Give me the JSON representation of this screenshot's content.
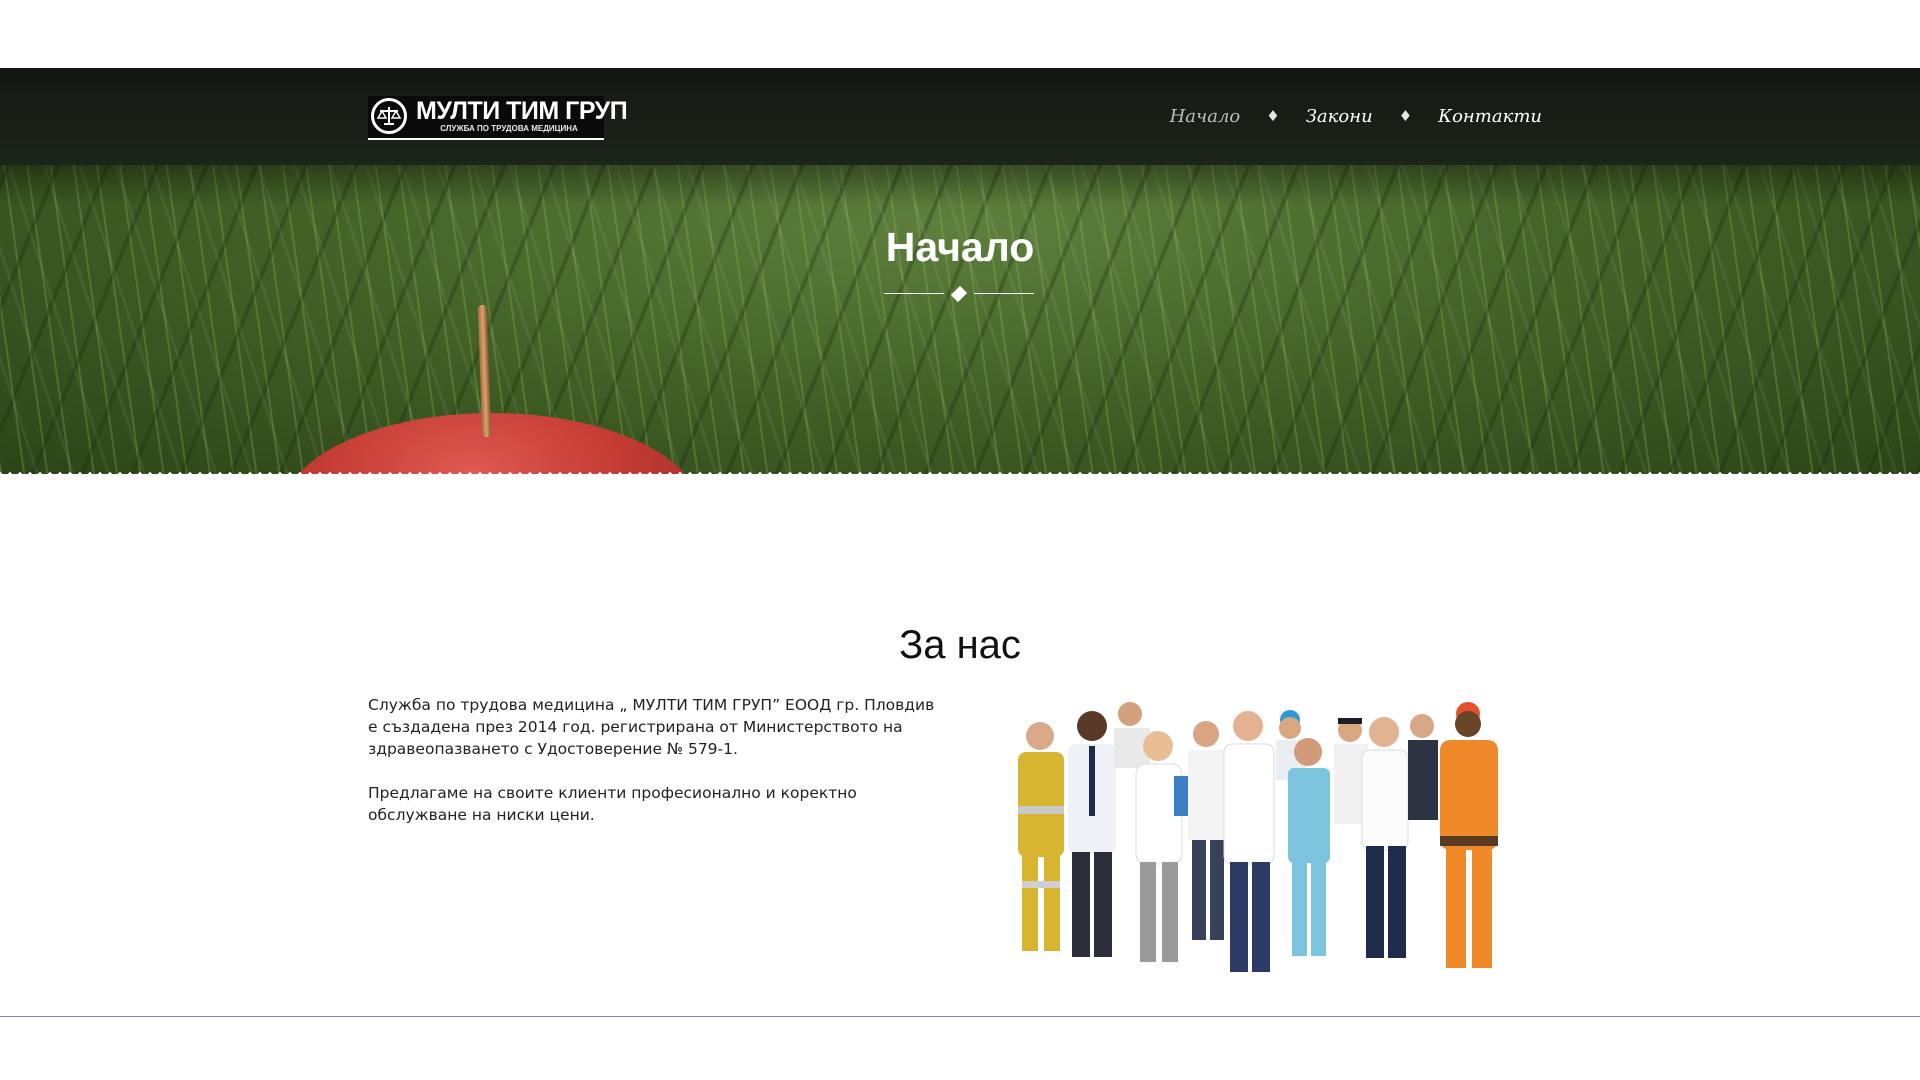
{
  "brand": {
    "name": "МУЛТИ ТИМ ГРУП",
    "tagline": "СЛУЖБА ПО ТРУДОВА МЕДИЦИНА",
    "emblem_icon": "scales-icon"
  },
  "nav": {
    "items": [
      {
        "label": "Начало",
        "active": true
      },
      {
        "label": "Закони",
        "active": false
      },
      {
        "label": "Контакти",
        "active": false
      }
    ],
    "separator": "♦"
  },
  "hero": {
    "title": "Начало"
  },
  "about": {
    "title": "За нас",
    "paragraphs": [
      "Служба по трудова медицина „ МУЛТИ ТИМ ГРУП” ЕООД гр. Пловдив е създадена през 2014 год. регистрирана от Министерството на здравеопазването с Удостоверение № 579-1.",
      "Предлагаме на своите клиенти професионално и коректно обслужване на ниски цени."
    ],
    "image_subject": "group-of-workers-in-uniforms"
  },
  "colors": {
    "navbar": "#161c15",
    "hero_green": "#4a6b2e",
    "text": "#222222"
  }
}
